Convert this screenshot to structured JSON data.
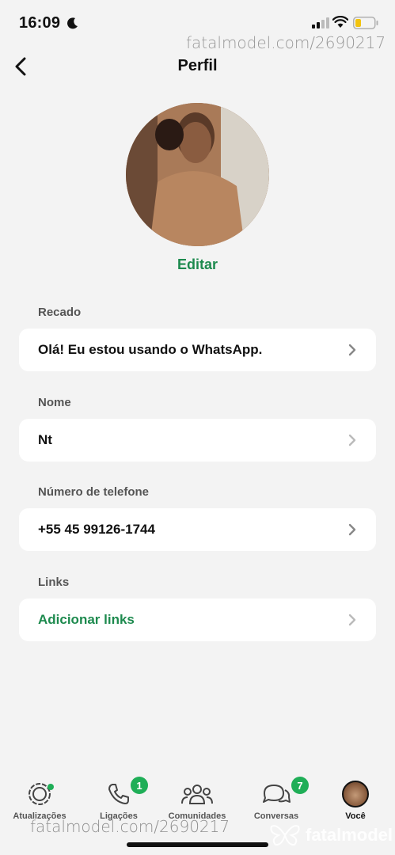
{
  "status_bar": {
    "time": "16:09"
  },
  "watermark": {
    "top": "fatalmodel.com/2690217",
    "bottom": "fatalmodel.com/2690217",
    "brand": "fatalmodel"
  },
  "header": {
    "title": "Perfil"
  },
  "profile": {
    "edit_label": "Editar"
  },
  "sections": [
    {
      "label": "Recado",
      "value": "Olá! Eu estou usando o WhatsApp."
    },
    {
      "label": "Nome",
      "value": "Nt"
    },
    {
      "label": "Número de telefone",
      "value": "+55 45 99126-1744"
    },
    {
      "label": "Links",
      "value": "Adicionar links"
    }
  ],
  "tab_bar": {
    "tabs": [
      {
        "label": "Atualizações",
        "icon": "updates-icon"
      },
      {
        "label": "Ligações",
        "icon": "phone-icon",
        "badge": "1"
      },
      {
        "label": "Comunidades",
        "icon": "communities-icon"
      },
      {
        "label": "Conversas",
        "icon": "chats-icon",
        "badge": "7"
      },
      {
        "label": "Você",
        "icon": "avatar"
      }
    ]
  },
  "colors": {
    "accent_green": "#1d8a4e",
    "badge_green": "#1fae57",
    "background": "#f3f3f3"
  }
}
